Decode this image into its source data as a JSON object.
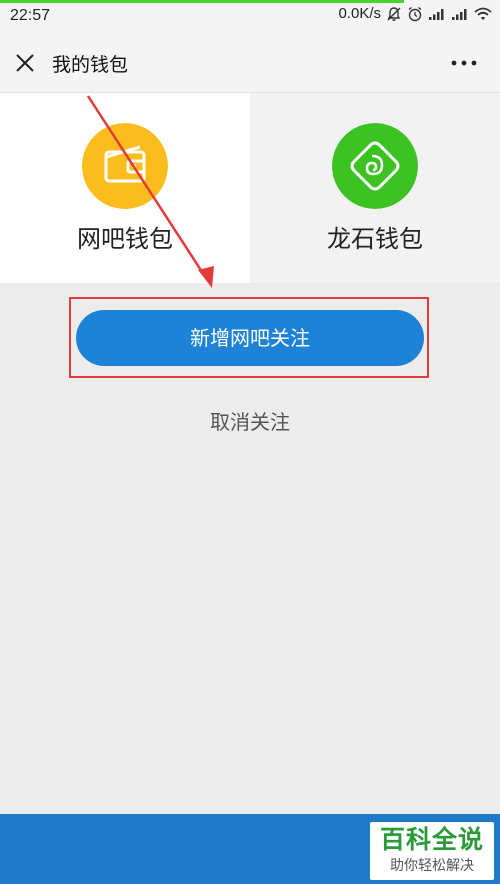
{
  "status_bar": {
    "time": "22:57",
    "network_speed": "0.0K/s",
    "icons": [
      "bell-off-icon",
      "alarm-icon",
      "signal-icon",
      "signal-icon",
      "wifi-icon"
    ]
  },
  "title_bar": {
    "close_icon": "close-icon",
    "title": "我的钱包",
    "more_icon": "more-icon"
  },
  "wallets": [
    {
      "label": "网吧钱包",
      "icon": "wallet-icon",
      "color": "#fbbd1d"
    },
    {
      "label": "龙石钱包",
      "icon": "dragon-stone-icon",
      "color": "#3cc223"
    }
  ],
  "actions": {
    "follow_label": "新增网吧关注",
    "unfollow_label": "取消关注"
  },
  "colors": {
    "primary": "#1e83d6",
    "bottom_bar": "#1e7ac8",
    "annotation": "#e23b3b"
  },
  "watermark": {
    "main": "百科全说",
    "sub": "助你轻松解决"
  }
}
